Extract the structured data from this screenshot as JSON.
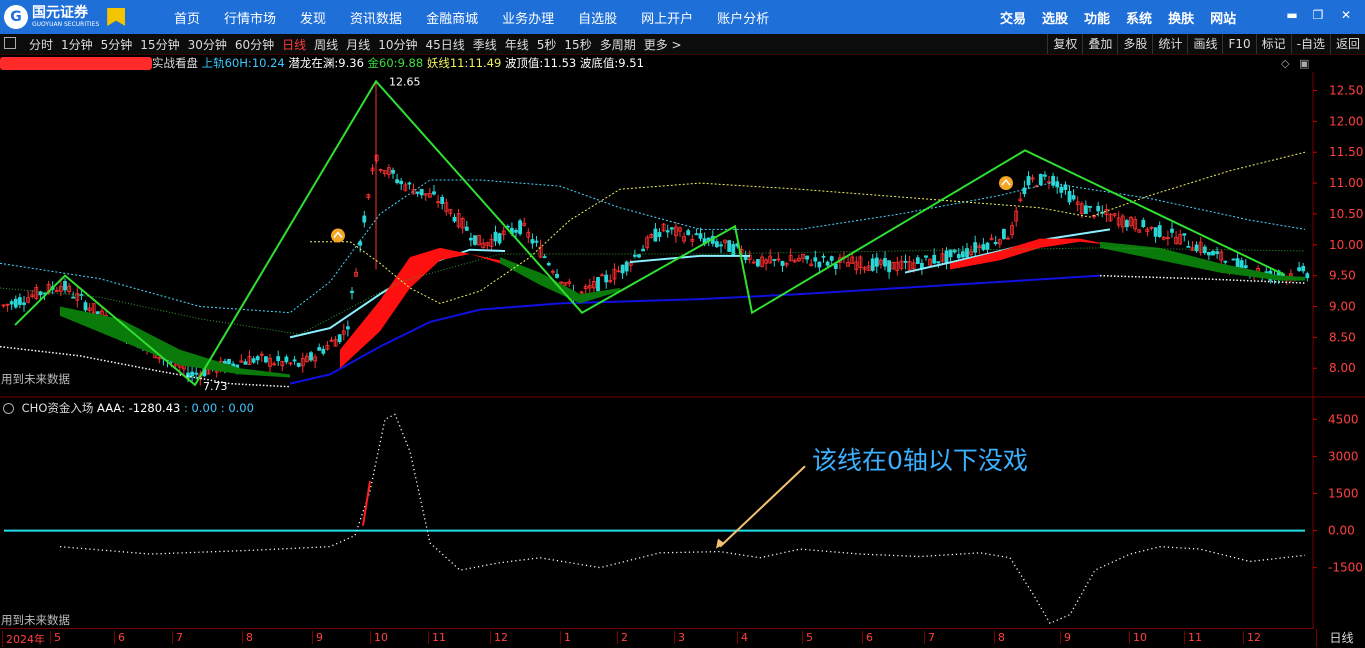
{
  "app": {
    "logo_cn": "国元证券",
    "logo_en": "GUOYUAN SECURITIES",
    "nav_left": [
      "首页",
      "行情市场",
      "发现",
      "资讯数据",
      "金融商城",
      "业务办理",
      "自选股",
      "网上开户",
      "账户分析"
    ],
    "nav_right": [
      "交易",
      "选股",
      "功能",
      "系统",
      "换肤",
      "网站"
    ]
  },
  "toolbar": {
    "periods": [
      "分时",
      "1分钟",
      "5分钟",
      "15分钟",
      "30分钟",
      "60分钟",
      "日线",
      "周线",
      "月线",
      "10分钟",
      "45日线",
      "季线",
      "年线",
      "5秒",
      "15秒",
      "多周期",
      "更多 >"
    ],
    "active_period": "日线",
    "tools": [
      "复权",
      "叠加",
      "多股",
      "统计",
      "画线",
      "F10",
      "标记",
      "-自选",
      "返回"
    ]
  },
  "main_indicator": {
    "name_tail": "实战看盘",
    "items": [
      {
        "label": "上轨60H:",
        "value": "10.24",
        "color": "#3ec8ff"
      },
      {
        "label": "潜龙在渊:",
        "value": "9.36",
        "color": "#ffffff"
      },
      {
        "label": "金60:",
        "value": "9.88",
        "color": "#40e040"
      },
      {
        "label": "妖线11:",
        "value": "11.49",
        "color": "#f0f060"
      },
      {
        "label": "波顶值:",
        "value": "11.53",
        "color": "#ffffff"
      },
      {
        "label": "波底值:",
        "value": "9.51",
        "color": "#ffffff"
      }
    ],
    "future_note": "用到未来数据",
    "peak_label": "12.65",
    "trough_label": "7.73"
  },
  "price_axis": {
    "ticks": [
      "12.50",
      "12.00",
      "11.50",
      "11.00",
      "10.50",
      "10.00",
      "9.50",
      "9.00",
      "8.50",
      "8.00"
    ],
    "min": 7.55,
    "max": 12.8
  },
  "sub_indicator": {
    "name": "CHO资金入场",
    "series_label": "AAA:",
    "series_value": "-1280.43",
    "extra_values": ": 0.00 : 0.00",
    "future_note": "用到未来数据",
    "ticks": [
      "4500",
      "3000",
      "1500",
      "0.00",
      "-1500"
    ],
    "min": -3900,
    "max": 5200
  },
  "annotation": {
    "text": "该线在0轴以下没戏"
  },
  "time_axis": {
    "labels": [
      "2024年",
      "5",
      "6",
      "7",
      "8",
      "9",
      "10",
      "11",
      "12",
      "1",
      "2",
      "3",
      "4",
      "5",
      "6",
      "7",
      "8",
      "9",
      "10",
      "11",
      "12"
    ],
    "period": "日线"
  },
  "colors": {
    "up": "#ff3030",
    "down": "#2ad5d5",
    "zero_line": "#20e0e8",
    "base_line": "#1010e0",
    "green_band": "#0a7a0a",
    "red_band": "#ff1010",
    "trend_line": "#30e030"
  }
}
